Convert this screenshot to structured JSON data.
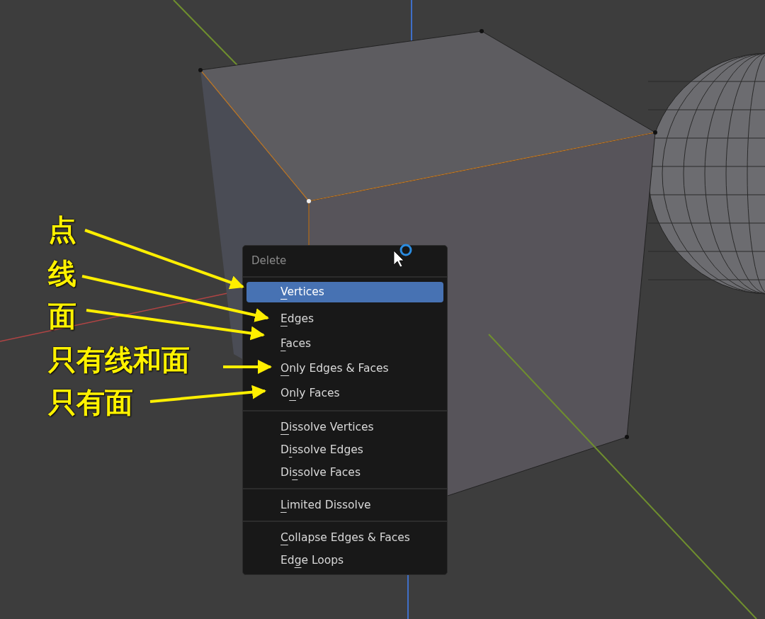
{
  "menu": {
    "title": "Delete",
    "sections": [
      {
        "items": [
          {
            "key": "V",
            "after": "ertices",
            "selected": true
          },
          {
            "key": "E",
            "after": "dges",
            "selected": false
          },
          {
            "key": "F",
            "after": "aces",
            "selected": false
          },
          {
            "key": "O",
            "after": "nly Edges & Faces",
            "selected": false
          },
          {
            "before": "O",
            "key": "n",
            "after": "ly Faces",
            "selected": false
          }
        ]
      },
      {
        "items": [
          {
            "key": "D",
            "after": "issolve Vertices",
            "selected": false
          },
          {
            "before": "D",
            "key": "i",
            "after": "ssolve Edges",
            "selected": false
          },
          {
            "before": "Di",
            "key": "s",
            "after": "solve Faces",
            "selected": false
          }
        ]
      },
      {
        "items": [
          {
            "key": "L",
            "after": "imited Dissolve",
            "selected": false
          }
        ]
      },
      {
        "items": [
          {
            "key": "C",
            "after": "ollapse Edges & Faces",
            "selected": false
          },
          {
            "before": "Ed",
            "key": "g",
            "after": "e Loops",
            "selected": false
          }
        ]
      }
    ]
  },
  "annotations": [
    {
      "text": "点"
    },
    {
      "text": "线"
    },
    {
      "text": "面"
    },
    {
      "text": "只有线和面"
    },
    {
      "text": "只有面"
    }
  ]
}
